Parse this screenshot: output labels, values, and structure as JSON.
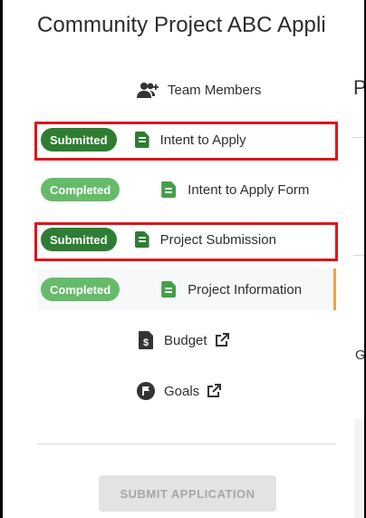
{
  "app": {
    "title": "Community Project ABC Appli"
  },
  "nav": {
    "team_members": {
      "label": "Team Members",
      "icon": "team-members-icon"
    },
    "intent_to_apply": {
      "status": "Submitted",
      "label": "Intent to Apply"
    },
    "intent_to_apply_form": {
      "status": "Completed",
      "label": "Intent to Apply Form"
    },
    "project_submission": {
      "status": "Submitted",
      "label": "Project Submission"
    },
    "project_information": {
      "status": "Completed",
      "label": "Project Information"
    },
    "budget": {
      "label": "Budget"
    },
    "goals": {
      "label": "Goals"
    }
  },
  "actions": {
    "submit_label": "SUBMIT APPLICATION"
  },
  "right_pane": {
    "heading_fragment": "P",
    "text_fragment": "Ge"
  },
  "colors": {
    "submitted": "#2e7d32",
    "completed": "#66bb6a",
    "highlight_box": "#e0141b",
    "active_indicator": "#f0a050"
  }
}
